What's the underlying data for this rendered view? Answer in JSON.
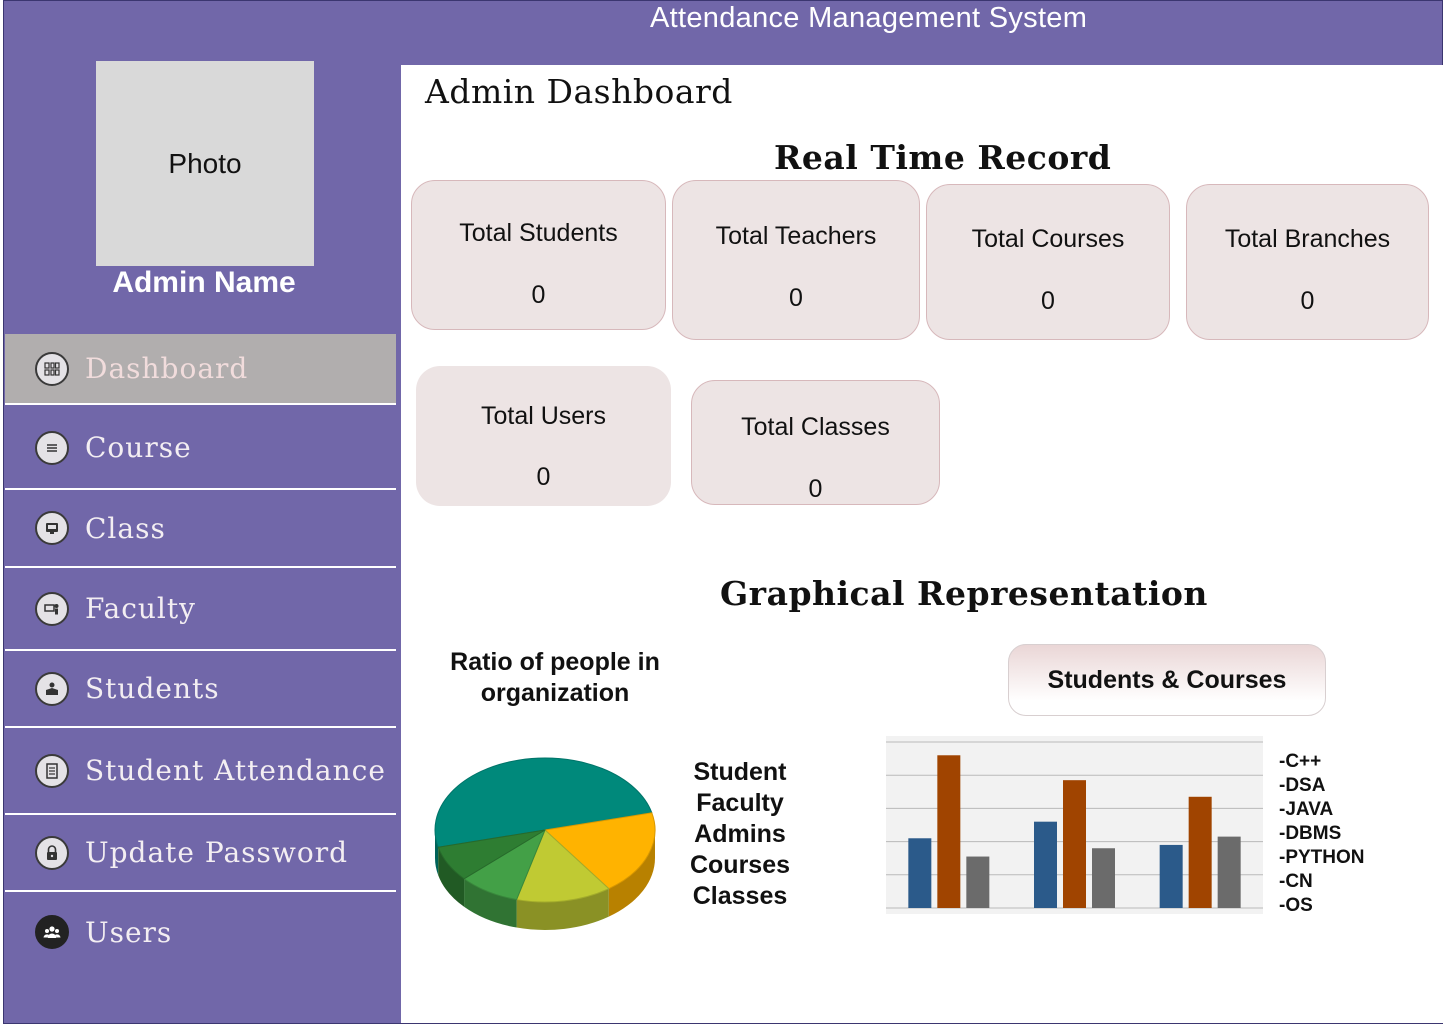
{
  "app": {
    "title": "Attendance Management System"
  },
  "profile": {
    "photo_label": "Photo",
    "name": "Admin Name"
  },
  "sidebar": {
    "items": [
      {
        "label": "Dashboard",
        "icon": "dashboard-icon",
        "active": true
      },
      {
        "label": "Course",
        "icon": "list-icon"
      },
      {
        "label": "Class",
        "icon": "classroom-icon"
      },
      {
        "label": "Faculty",
        "icon": "teacher-icon"
      },
      {
        "label": "Students",
        "icon": "student-icon"
      },
      {
        "label": "Student Attendance",
        "icon": "attendance-sheet-icon"
      },
      {
        "label": "Update Password",
        "icon": "lock-icon"
      },
      {
        "label": "Users",
        "icon": "users-icon"
      }
    ]
  },
  "main": {
    "page_title": "Admin Dashboard",
    "realtime_title": "Real Time Record",
    "stats": [
      {
        "label": "Total Students",
        "value": "0"
      },
      {
        "label": "Total Teachers",
        "value": "0"
      },
      {
        "label": "Total Courses",
        "value": "0"
      },
      {
        "label": "Total Branches",
        "value": "0"
      },
      {
        "label": "Total Users",
        "value": "0"
      },
      {
        "label": "Total Classes",
        "value": "0"
      }
    ],
    "graph_title": "Graphical Representation",
    "pie": {
      "title": "Ratio of people in organization",
      "legend": [
        "Student",
        "Faculty",
        "Admins",
        "Courses",
        "Classes"
      ]
    },
    "bar": {
      "button_label": "Students & Courses",
      "legend": [
        "-C++",
        "-DSA",
        "-JAVA",
        "-DBMS",
        "-PYTHON",
        "-CN",
        "-OS"
      ]
    }
  },
  "chart_data": [
    {
      "type": "pie",
      "title": "Ratio of people in organization",
      "slices": [
        {
          "name": "Student",
          "value": 50,
          "color": "#00897b"
        },
        {
          "name": "Faculty",
          "value": 19,
          "color": "#ffb300"
        },
        {
          "name": "Admins",
          "value": 14,
          "color": "#c0ca33"
        },
        {
          "name": "Courses",
          "value": 9,
          "color": "#43a047"
        },
        {
          "name": "Classes",
          "value": 8,
          "color": "#2e7d32"
        }
      ]
    },
    {
      "type": "bar",
      "title": "Students & Courses",
      "categories": [
        "",
        "",
        ""
      ],
      "series": [
        {
          "values": [
            4.2,
            5.2,
            3.8
          ],
          "color": "#2b5a8a"
        },
        {
          "values": [
            9.2,
            7.7,
            6.7
          ],
          "color": "#a04400"
        },
        {
          "values": [
            3.1,
            3.6,
            4.3
          ],
          "color": "#6b6b6b"
        }
      ],
      "ylim": [
        0,
        10
      ],
      "grid": true
    }
  ]
}
